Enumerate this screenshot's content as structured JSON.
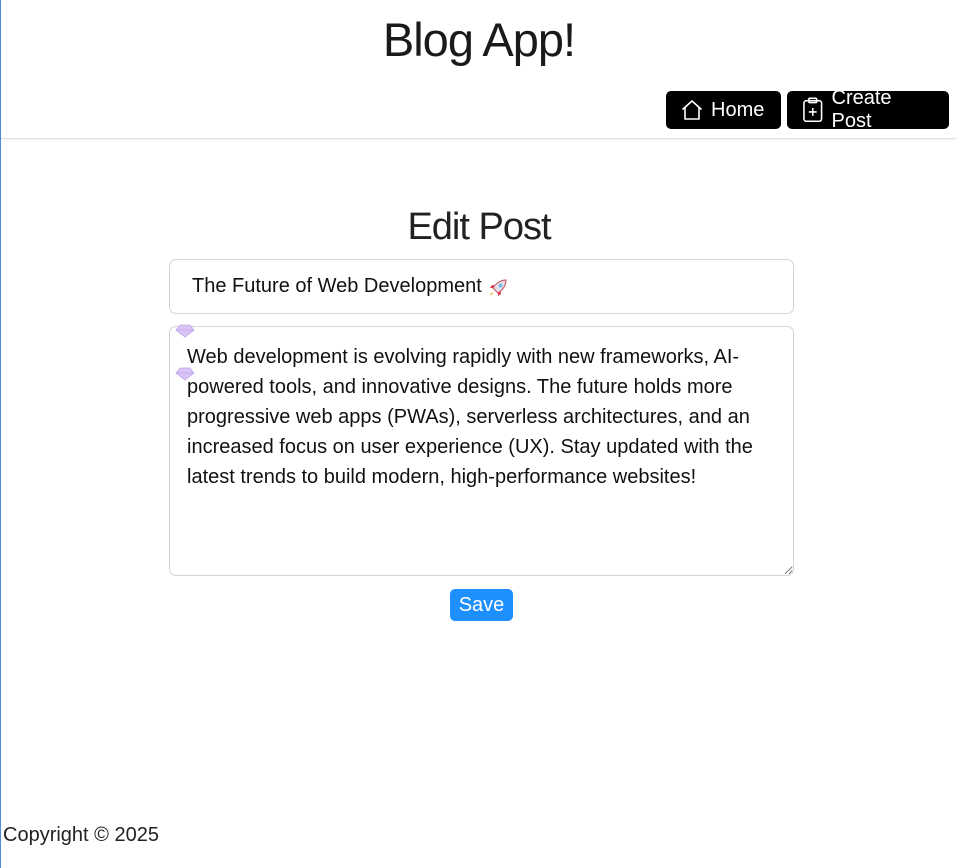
{
  "header": {
    "app_title": "Blog App!",
    "nav": {
      "home_label": "Home",
      "create_post_label": "Create Post"
    }
  },
  "edit_form": {
    "heading": "Edit Post",
    "title_value": "The Future of Web Development",
    "title_emoji_icon": "rocket-icon",
    "content_value": "Web development is evolving rapidly with new frameworks, AI-powered tools, and innovative designs. The future holds more progressive web apps (PWAs), serverless architectures, and an increased focus on user experience (UX). Stay updated with the latest trends to build modern, high-performance websites!",
    "save_label": "Save"
  },
  "footer": {
    "copyright": "Copyright © 2025"
  },
  "colors": {
    "nav_button_bg": "#000000",
    "save_button_bg": "#1e8fff",
    "border": "#d4d4d4"
  }
}
